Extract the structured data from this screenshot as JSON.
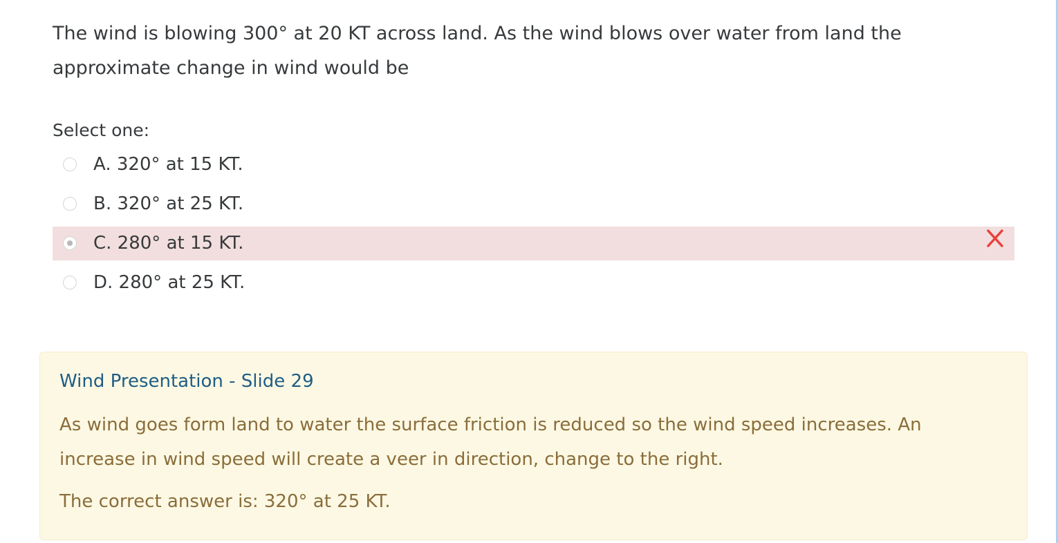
{
  "question": {
    "text": "The wind is blowing 300° at 20 KT across land. As the wind blows over water from land the approximate change in wind would be",
    "prompt": "Select one:"
  },
  "answers": [
    {
      "label": "A. 320° at 15 KT.",
      "selected": false,
      "state": "neutral"
    },
    {
      "label": "B. 320° at 25 KT.",
      "selected": false,
      "state": "neutral"
    },
    {
      "label": "C. 280° at 15 KT.",
      "selected": true,
      "state": "incorrect"
    },
    {
      "label": "D. 280° at 25 KT.",
      "selected": false,
      "state": "neutral"
    }
  ],
  "feedback": {
    "link_text": "Wind Presentation - Slide 29",
    "explanation": "As wind goes form land to water the surface friction is reduced so the wind speed increases. An increase in wind speed will create a veer in direction, change to the right.",
    "correct_answer": "The correct answer is: 320° at 25 KT."
  },
  "icons": {
    "incorrect_mark": "cross-icon"
  },
  "colors": {
    "incorrect_background": "#f2dede",
    "incorrect_mark": "#e8413c",
    "feedback_background": "#fcf8e3",
    "feedback_text": "#8a6d3b",
    "link": "#1f5d86"
  }
}
